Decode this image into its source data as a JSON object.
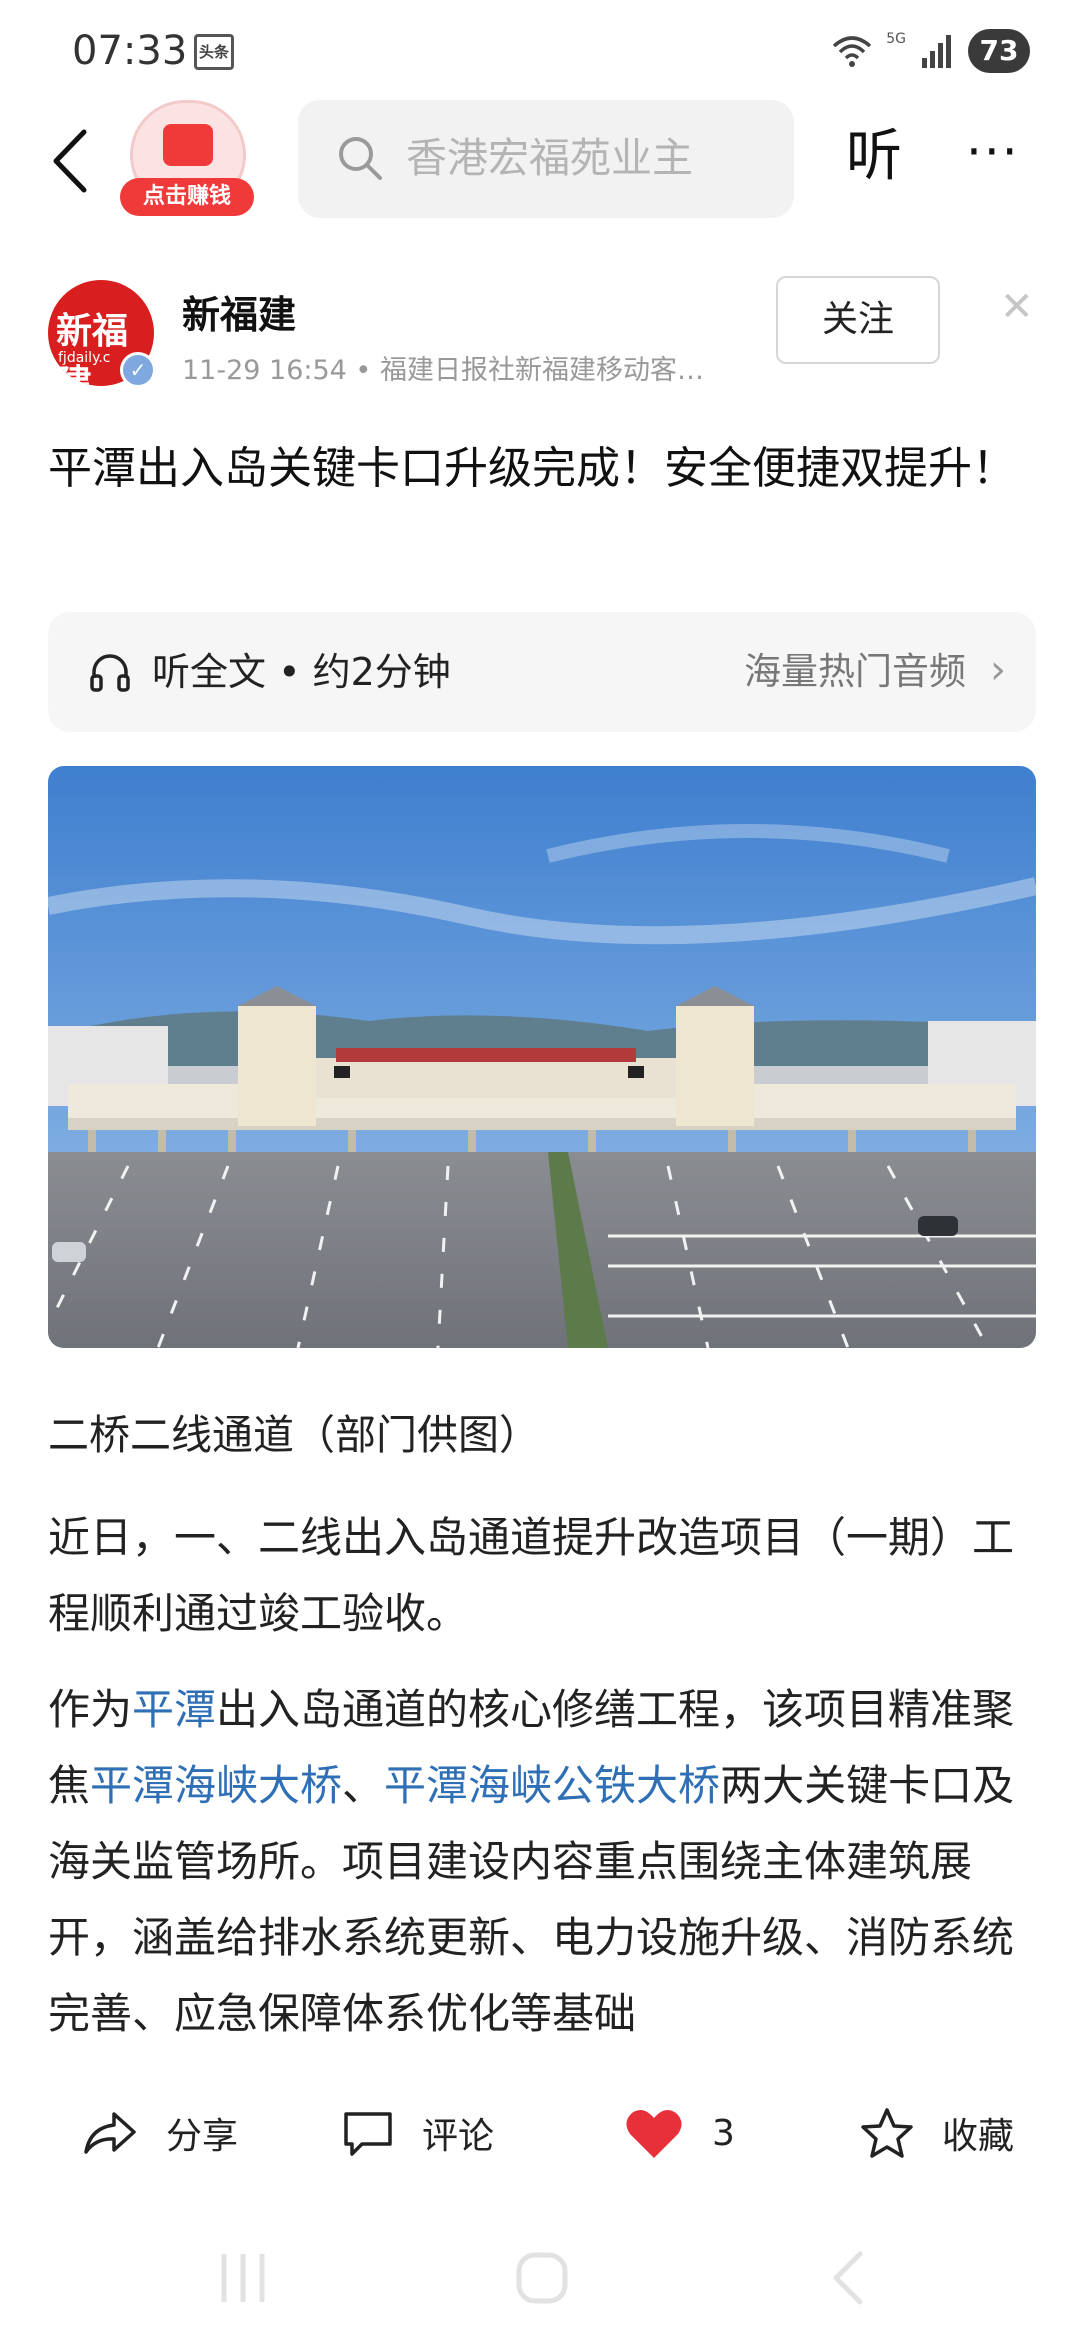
{
  "status": {
    "time": "07:33",
    "app_badge": "头条",
    "network": "5G",
    "battery": "73"
  },
  "nav": {
    "earn_label": "点击赚钱",
    "search_placeholder": "香港宏福苑业主",
    "listen_label": "听",
    "more_label": "···"
  },
  "author": {
    "name": "新福建",
    "avatar_text": "新福建",
    "avatar_sub": "fjdaily.c",
    "meta": "11-29 16:54 • 福建日报社新福建移动客…",
    "follow_label": "关注"
  },
  "article": {
    "title": "平潭出入岛关键卡口升级完成！安全便捷双提升！",
    "listen_text": "听全文 • 约2分钟",
    "listen_link": "海量热门音频",
    "caption": "二桥二线通道（部门供图）",
    "para1": "近日，一、二线出入岛通道提升改造项目（一期）工程顺利通过竣工验收。",
    "para2": {
      "t1": "作为",
      "l1": "平潭",
      "t2": "出入岛通道的核心修缮工程，该项目精准聚焦",
      "l2": "平潭海峡大桥",
      "t3": "、",
      "l3": "平潭海峡公铁大桥",
      "t4": "两大关键卡口及海关监管场所。项目建设内容重点围绕主体建筑展开，涵盖给排水系统更新、电力设施升级、消防系统完善、应急保障体系优化等基础"
    }
  },
  "actions": {
    "share": "分享",
    "comment": "评论",
    "like_count": "3",
    "collect": "收藏"
  },
  "colors": {
    "accent_red": "#f03a3a",
    "link_blue": "#2f6fb5",
    "like_red": "#e8303a"
  }
}
